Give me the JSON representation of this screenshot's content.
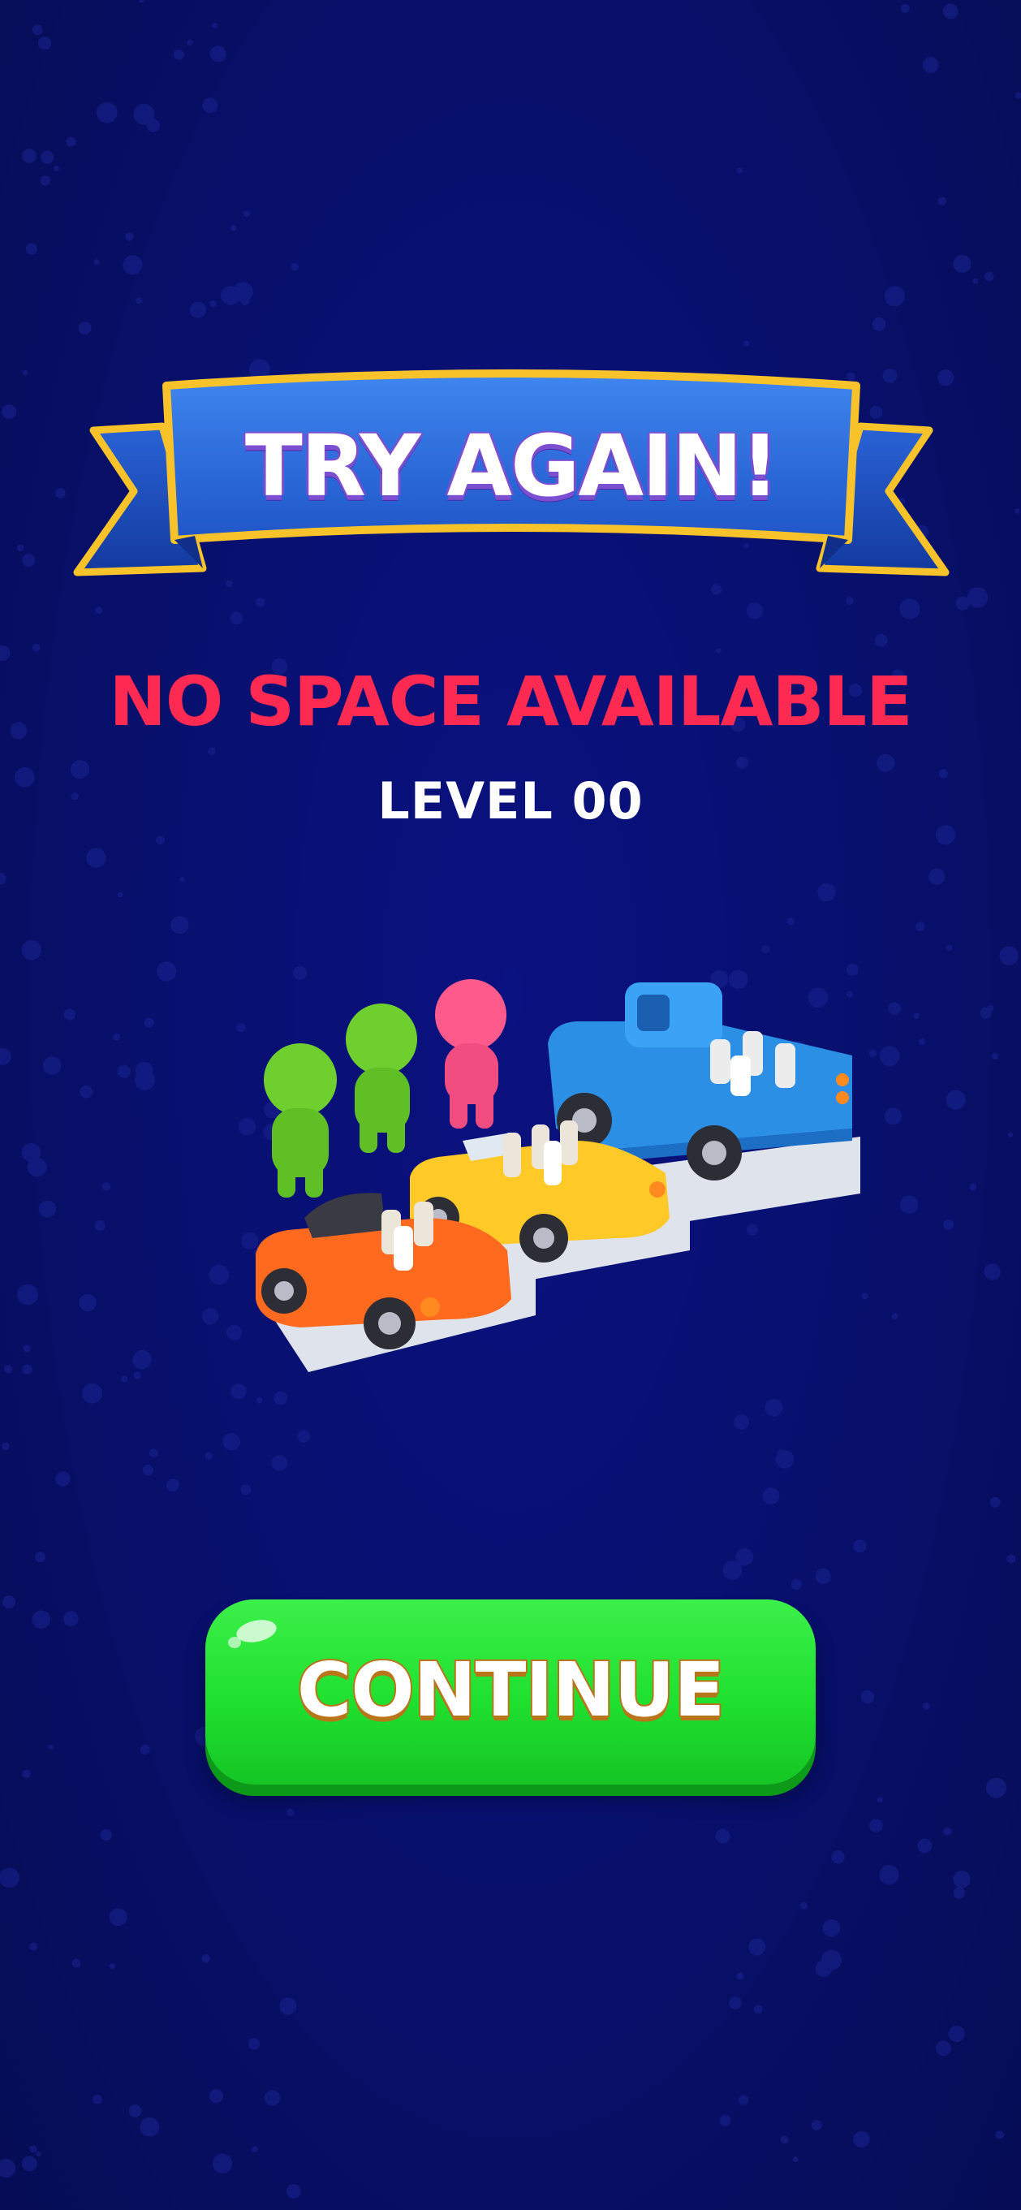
{
  "banner": {
    "title": "TRY AGAIN!"
  },
  "message": {
    "reason": "NO SPACE AVAILABLE",
    "level": "LEVEL 00"
  },
  "illustration": {
    "people": [
      "green",
      "green",
      "pink"
    ],
    "vehicles": [
      "blue-pickup",
      "yellow-convertible",
      "orange-convertible"
    ]
  },
  "actions": {
    "continue_label": "CONTINUE"
  },
  "colors": {
    "background": "#081070",
    "banner": "#2f6fe0",
    "banner_trim": "#f7c22a",
    "reason_text": "#ff2a52",
    "button": "#1fe02f"
  }
}
